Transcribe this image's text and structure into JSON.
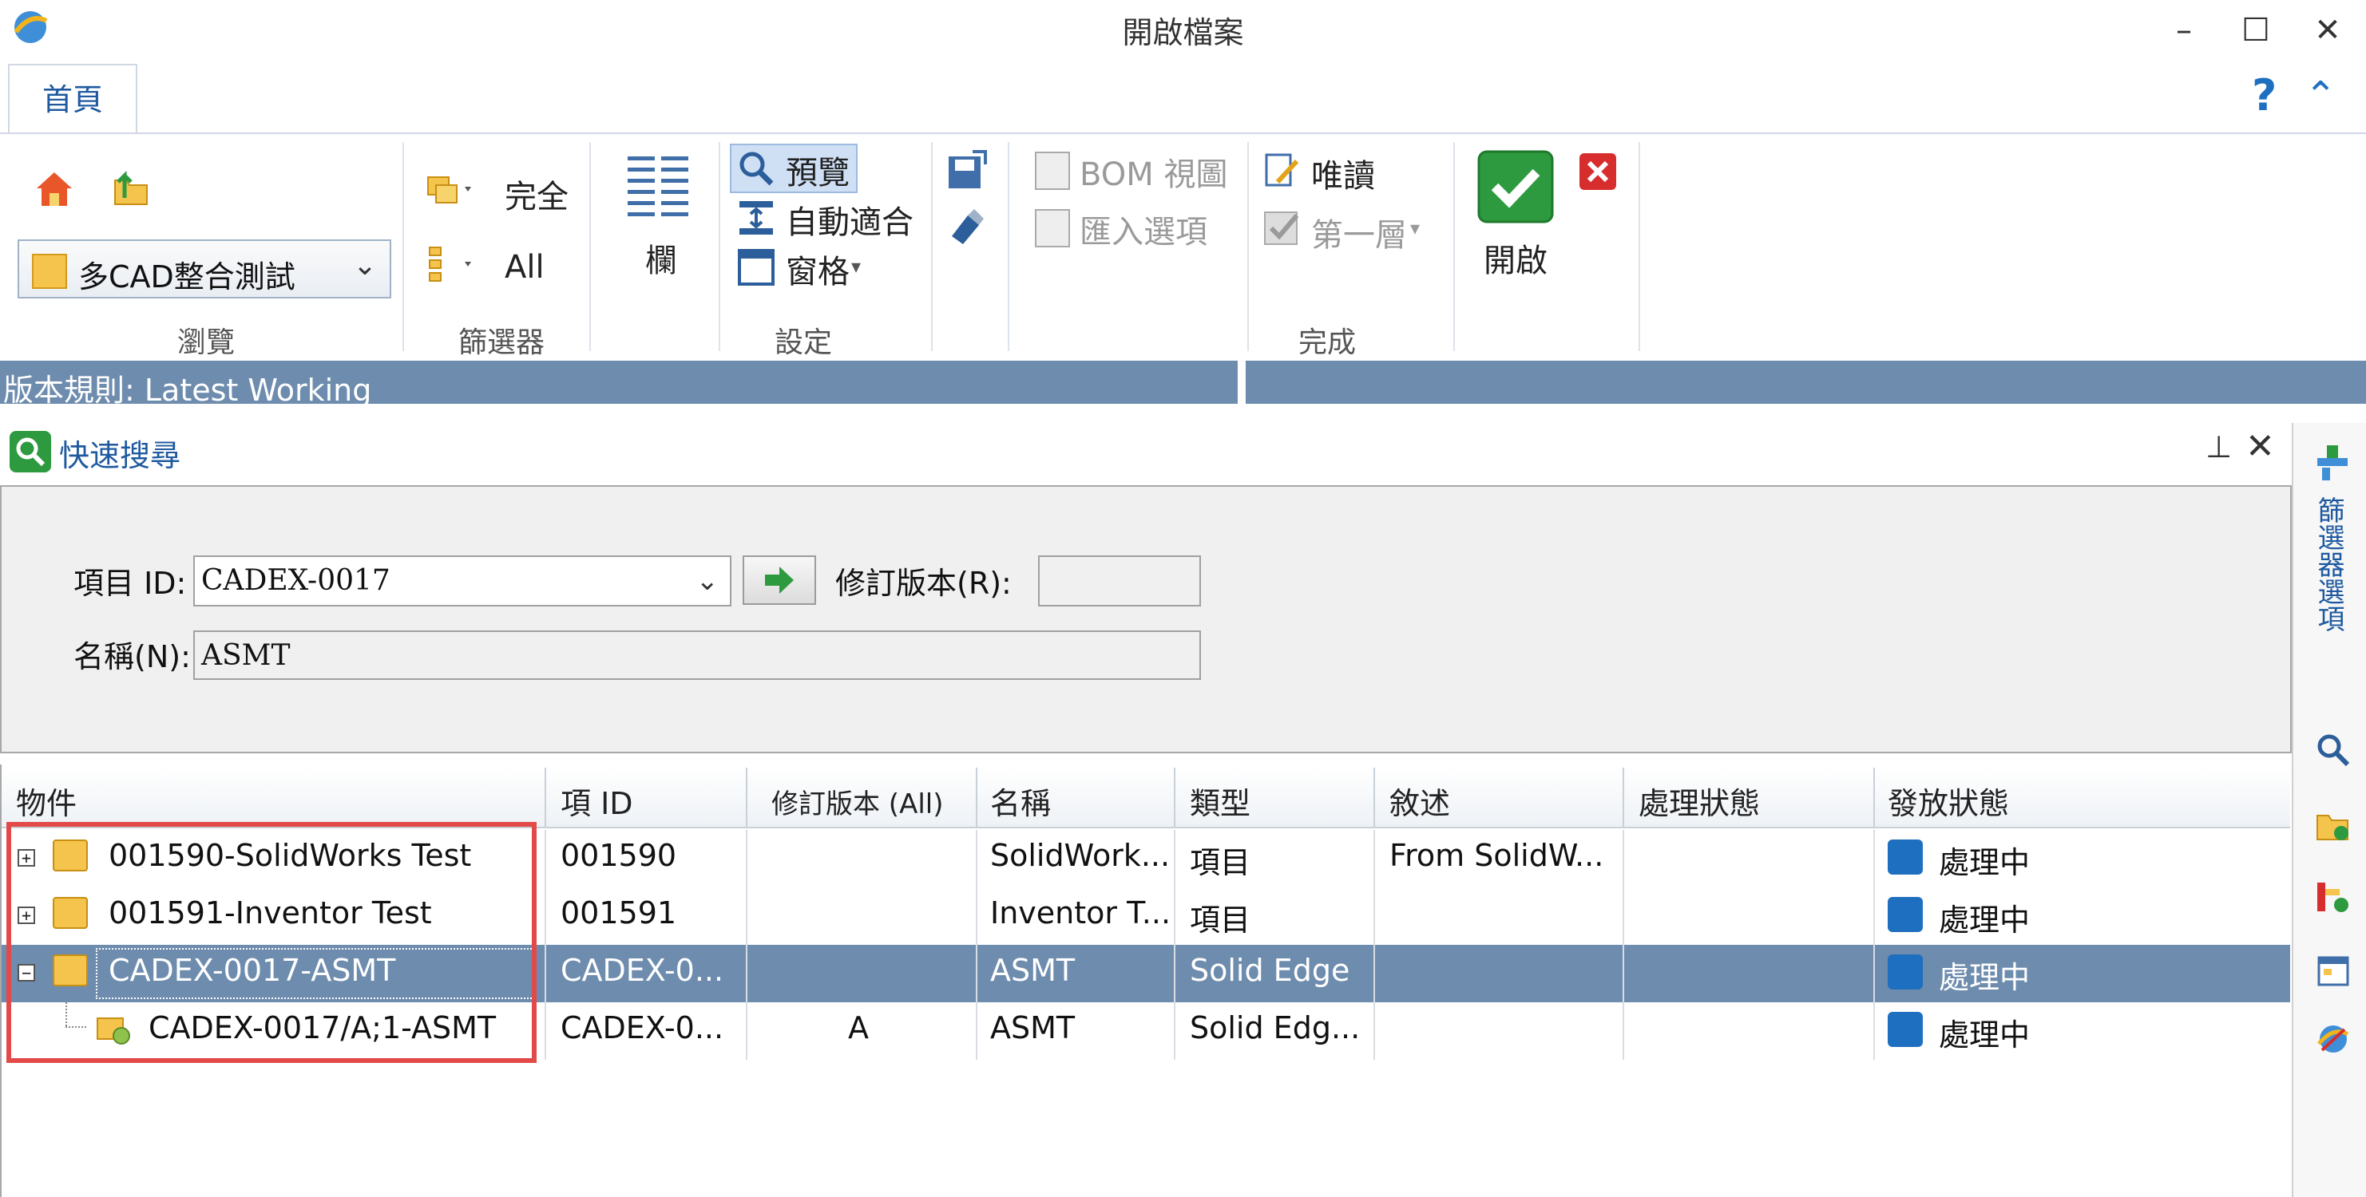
{
  "window": {
    "title": "開啟檔案",
    "minimize": "–",
    "maximize": "☐",
    "close": "✕"
  },
  "ribbon": {
    "tabs": [
      {
        "label": "首頁"
      }
    ],
    "help": "?",
    "collapse": "⌃",
    "browse": {
      "folder_value": "多CAD整合測試",
      "group_label": "瀏覽"
    },
    "filter": {
      "option1": "完全",
      "option2": "All",
      "group_label": "篩選器"
    },
    "settings": {
      "columns_label": "欄",
      "preview_label": "預覽",
      "autofit_label": "自動適合",
      "pane_label": "窗格",
      "group_label": "設定"
    },
    "finish": {
      "bom_label": "BOM 視圖",
      "import_label": "匯入選項",
      "readonly_label": "唯讀",
      "first_level_label": "第一層",
      "open_label": "開啟",
      "group_label": "完成"
    }
  },
  "version_rule": "版本規則: Latest Working",
  "quick_search": {
    "title": "快速搜尋",
    "pin": "⊥",
    "close": "✕",
    "item_id_label": "項目 ID:",
    "item_id_value": "CADEX-0017",
    "revision_label": "修訂版本(R):",
    "revision_value": "",
    "name_label": "名稱(N):",
    "name_value": "ASMT"
  },
  "grid": {
    "columns": [
      "物件",
      "項 ID",
      "修訂版本 (All)",
      "名稱",
      "類型",
      "敘述",
      "處理狀態",
      "發放狀態"
    ],
    "rows": [
      {
        "object": "001590-SolidWorks Test",
        "item_id": "001590",
        "revision": "",
        "name": "SolidWork...",
        "type": "項目",
        "description": "From SolidW...",
        "process_status": "",
        "release_status": "處理中",
        "expander": "+"
      },
      {
        "object": "001591-Inventor Test",
        "item_id": "001591",
        "revision": "",
        "name": "Inventor T...",
        "type": "項目",
        "description": "",
        "process_status": "",
        "release_status": "處理中",
        "expander": "+"
      },
      {
        "object": "CADEX-0017-ASMT",
        "item_id": "CADEX-0...",
        "revision": "",
        "name": "ASMT",
        "type": "Solid Edge",
        "description": "",
        "process_status": "",
        "release_status": "處理中",
        "expander": "−",
        "selected": true
      },
      {
        "object": "CADEX-0017/A;1-ASMT",
        "item_id": "CADEX-0...",
        "revision": "A",
        "name": "ASMT",
        "type": "Solid Edg...",
        "description": "",
        "process_status": "",
        "release_status": "處理中"
      }
    ]
  },
  "side_panel": {
    "filter_selection": "篩選器選項"
  },
  "colors": {
    "accent": "#1f5aa0",
    "selection": "#6e8cae",
    "highlight_border": "#e24a4a",
    "ok_green": "#2e9a3f"
  },
  "icons": [
    "app-logo-icon",
    "home-icon",
    "folder-up-icon",
    "filter-icon",
    "tree-icon",
    "columns-icon",
    "preview-icon",
    "autofit-icon",
    "pane-icon",
    "save-icon",
    "brush-icon",
    "bom-icon",
    "import-icon",
    "readonly-icon",
    "check-icon",
    "open-ok-icon",
    "cancel-icon",
    "search-icon",
    "arrow-go-icon",
    "expand-icon",
    "package-icon",
    "status-icon"
  ]
}
